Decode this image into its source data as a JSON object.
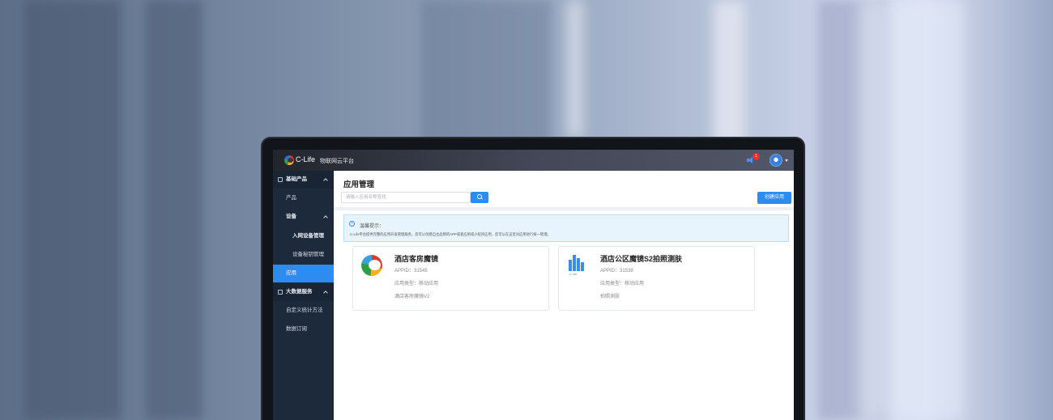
{
  "topbar": {
    "brand": "C-Life",
    "platform": "物联网云平台",
    "notification_count": "1"
  },
  "sidebar": {
    "items": [
      {
        "label": "基础产品"
      },
      {
        "label": "产品"
      },
      {
        "label": "设备"
      },
      {
        "label": "入网设备管理"
      },
      {
        "label": "设备秘钥管理"
      },
      {
        "label": "应用"
      },
      {
        "label": "大数据服务"
      },
      {
        "label": "自定义统计方法"
      },
      {
        "label": "数据订阅"
      }
    ]
  },
  "main": {
    "title": "应用管理",
    "search_placeholder": "请输入应用名称查找",
    "create_label": "创建应用",
    "notice": {
      "title": "温馨提示：",
      "text": "C-Life平台提供完整的应用开发管理服务，您可以创建自主品牌的APP或者应用或小程序应用，您可以在这里对应用进行统一管理。"
    },
    "cards": [
      {
        "name": "酒店客房魔镜",
        "appid": "APPID：31545",
        "type": "应用类型：移动应用",
        "desc": "酒店客房魔镜V2",
        "logo": "c-life-logo"
      },
      {
        "name": "酒店公区魔镜S2拍照测肤",
        "appid": "APPID：31538",
        "type": "应用类型：移动应用",
        "desc": "拍照测肤",
        "logo": "building-bars-logo"
      }
    ]
  },
  "colors": {
    "accent": "#2d8cf0",
    "sidebar": "#1d2a3c",
    "topbar": "#2b2e36"
  }
}
